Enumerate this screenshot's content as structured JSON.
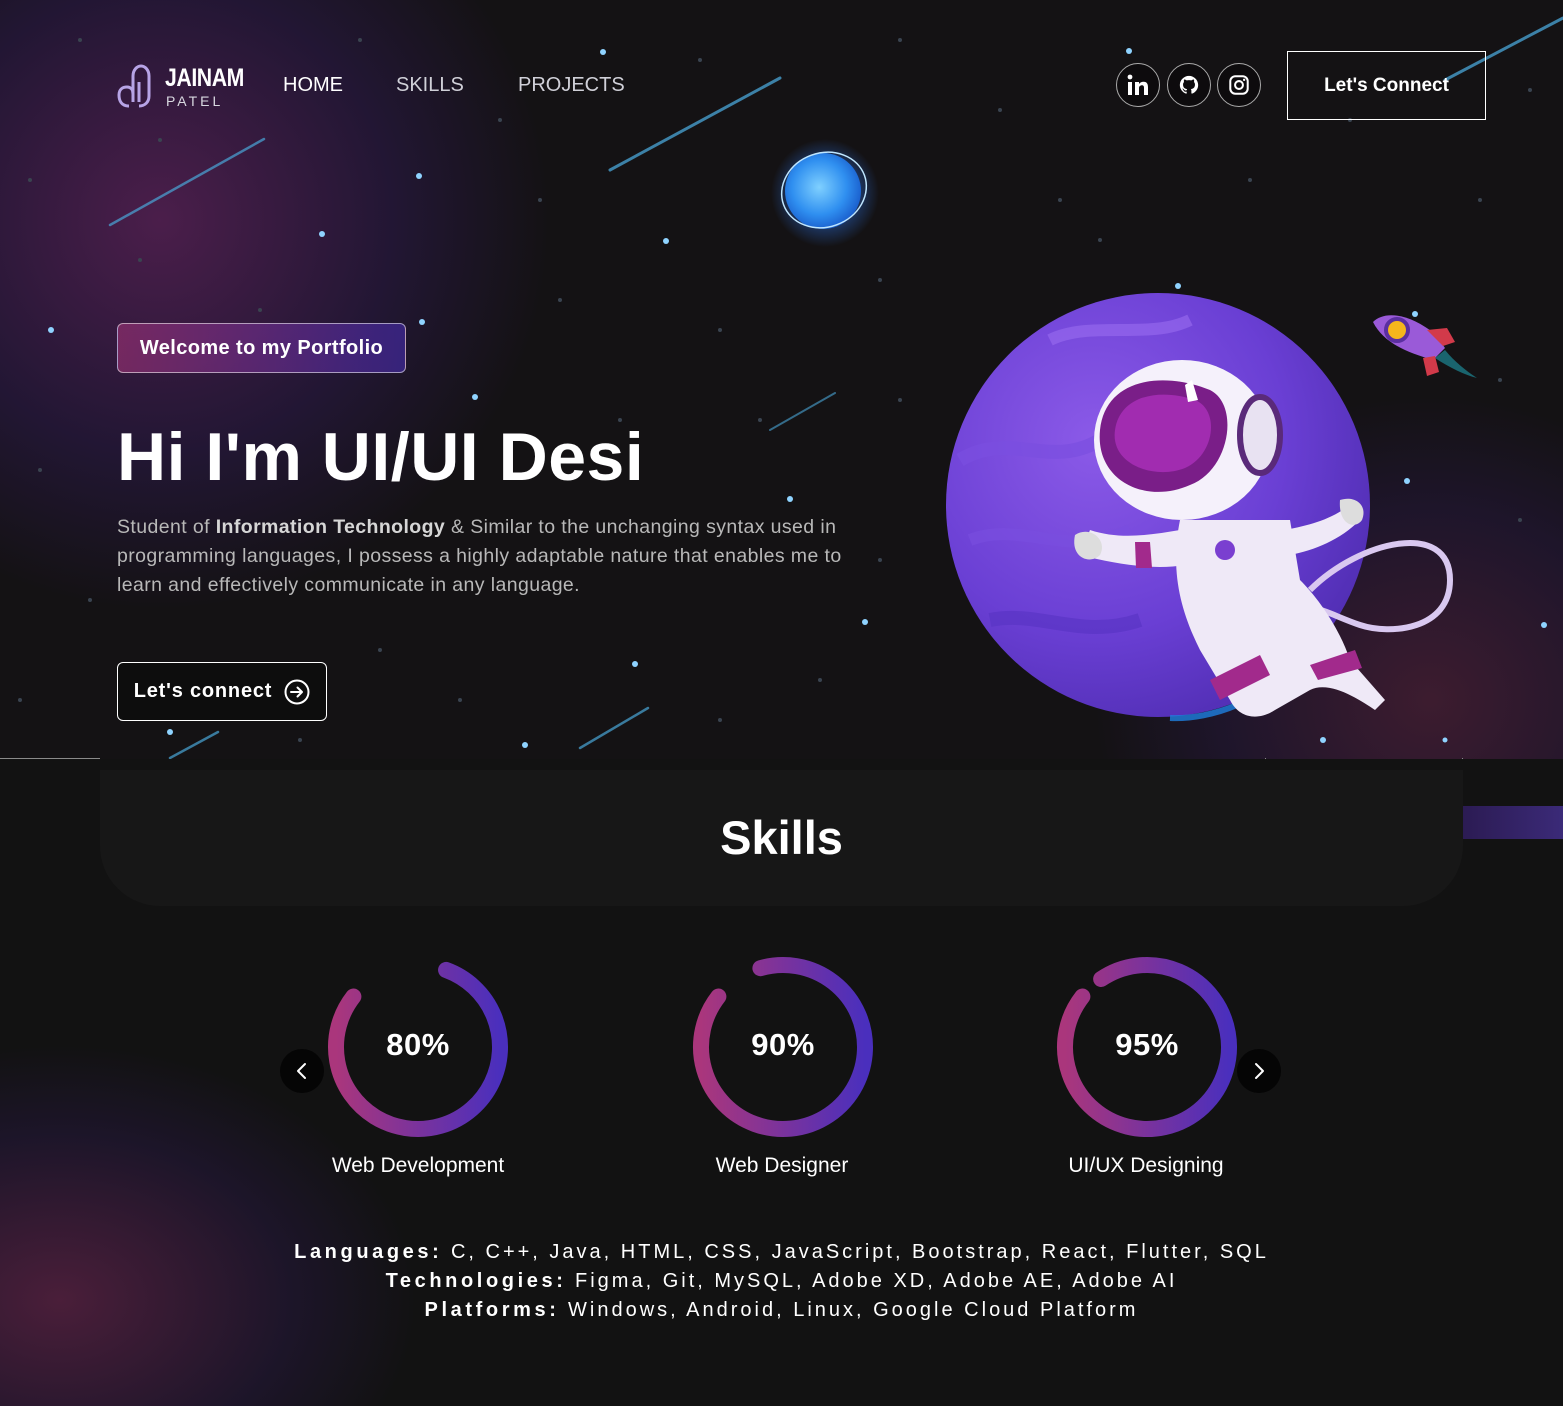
{
  "brand": {
    "name": "JAINAM",
    "subtitle": "PATEL"
  },
  "nav": {
    "links": [
      "HOME",
      "SKILLS",
      "PROJECTS"
    ],
    "socials": [
      "linkedin-icon",
      "github-icon",
      "instagram-icon"
    ],
    "cta_label": "Let's Connect"
  },
  "hero": {
    "tagline": "Welcome to my Portfolio",
    "headline": "Hi I'm UI/UI Desi",
    "bio_prefix": "Student of ",
    "bio_bold": "Information Technology",
    "bio_rest": " & Similar to the unchanging syntax used in programming languages, I possess a highly adaptable nature that enables me to learn and effectively communicate in any language.",
    "button_label": "Let's connect"
  },
  "skills": {
    "title": "Skills",
    "items": [
      {
        "label": "Web Development",
        "percent_text": "80%",
        "level": 0.8
      },
      {
        "label": "Web Designer",
        "percent_text": "90%",
        "level": 0.9
      },
      {
        "label": "UI/UX Designing",
        "percent_text": "95%",
        "level": 0.95
      }
    ],
    "stack": {
      "languages_label": "Languages:",
      "languages": " C, C++, Java, HTML, CSS, JavaScript, Bootstrap, React, Flutter, SQL",
      "technologies_label": "Technologies:",
      "technologies": " Figma, Git, MySQL, Adobe XD, Adobe AE, Adobe AI",
      "platforms_label": "Platforms:",
      "platforms": " Windows, Android, Linux, Google Cloud Platform"
    }
  },
  "colors": {
    "background": "#121212",
    "gradient_start": "#aa367c",
    "gradient_end": "#4a2fbd"
  }
}
